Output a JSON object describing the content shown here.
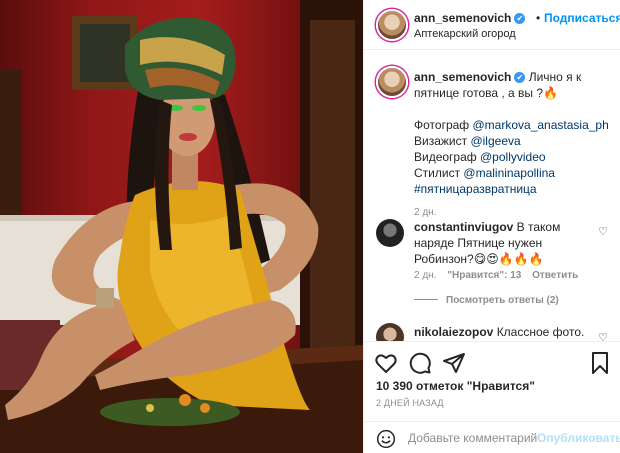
{
  "header": {
    "username": "ann_semenovich",
    "verified_glyph": "✔",
    "separator": "•",
    "follow_label": "Подписаться",
    "location": "Аптекарский огород"
  },
  "caption": {
    "username": "ann_semenovich",
    "text": " Лично я к пятнице готова , а вы ?🔥",
    "lines": [
      {
        "prefix": "Фотограф ",
        "mention": "@markova_anastasia_ph"
      },
      {
        "prefix": "Визажист ",
        "mention": "@ilgeeva"
      },
      {
        "prefix": "Видеограф ",
        "mention": "@pollyvideo"
      },
      {
        "prefix": "Стилист ",
        "mention": "@malininapollina"
      }
    ],
    "hashtag": "#пятницаразвратница",
    "time": "2 дн."
  },
  "comments": [
    {
      "username": "constantinviugov",
      "text": " В таком наряде Пятнице нужен Робинзон?😋😍🔥🔥🔥",
      "time": "2 дн.",
      "likes": "\"Нравится\": 13",
      "reply_label": "Ответить",
      "view_replies": "Посмотреть ответы (2)"
    },
    {
      "username": "nikolaiezopov",
      "text": " Классное фото."
    }
  ],
  "actions": {
    "likes_text": "10 390 отметок \"Нравится\"",
    "date": "2 дней назад"
  },
  "add_comment": {
    "placeholder": "Добавьте комментарий...",
    "post_label": "Опубликовать"
  },
  "colors": {
    "accent": "#0095f6",
    "verified": "#3897f0",
    "post_disabled": "#b2dffc",
    "mention": "#00376b",
    "muted": "#8e8e8e",
    "dress": "#e0a318"
  },
  "icons": [
    "verified-icon",
    "heart-icon",
    "comment-icon",
    "share-icon",
    "bookmark-icon",
    "emoji-icon"
  ]
}
